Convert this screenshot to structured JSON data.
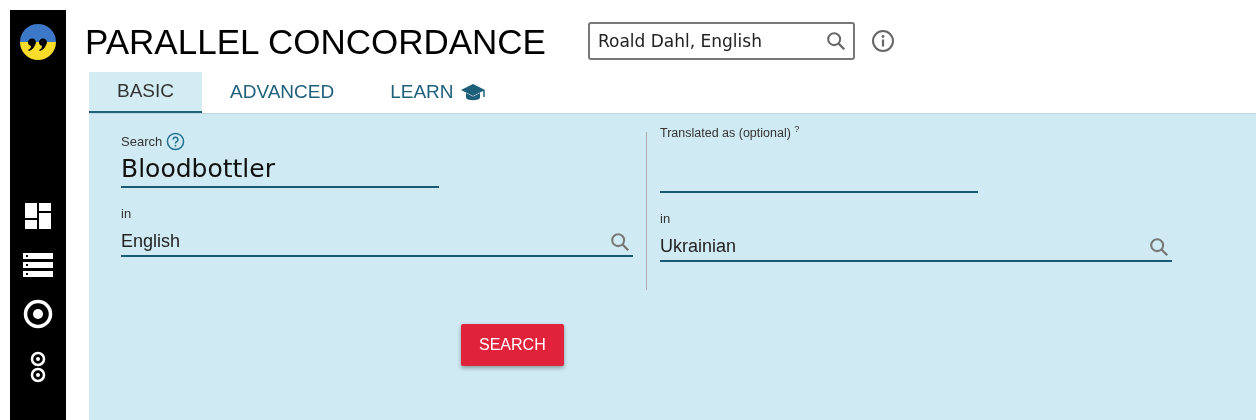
{
  "app": {
    "title": "PARALLEL CONCORDANCE"
  },
  "corpus_search": {
    "value": "Roald Dahl, English"
  },
  "sidebar": {
    "items": [
      {
        "kind": "dashboard"
      },
      {
        "kind": "list"
      },
      {
        "kind": "target"
      },
      {
        "kind": "pair"
      }
    ]
  },
  "tabs": [
    {
      "label": "BASIC",
      "selected": true,
      "kind": "text"
    },
    {
      "label": "ADVANCED",
      "selected": false,
      "kind": "text"
    },
    {
      "label": "LEARN",
      "selected": false,
      "kind": "icon"
    }
  ],
  "source": {
    "label": "Search",
    "value": "Bloodbottler",
    "language_label": "in",
    "language": "English"
  },
  "target": {
    "label": "Translated as (optional) $^{?}$",
    "language_label": "in",
    "language": "Ukrainian"
  },
  "search_button": {
    "label": "SEARCH"
  }
}
